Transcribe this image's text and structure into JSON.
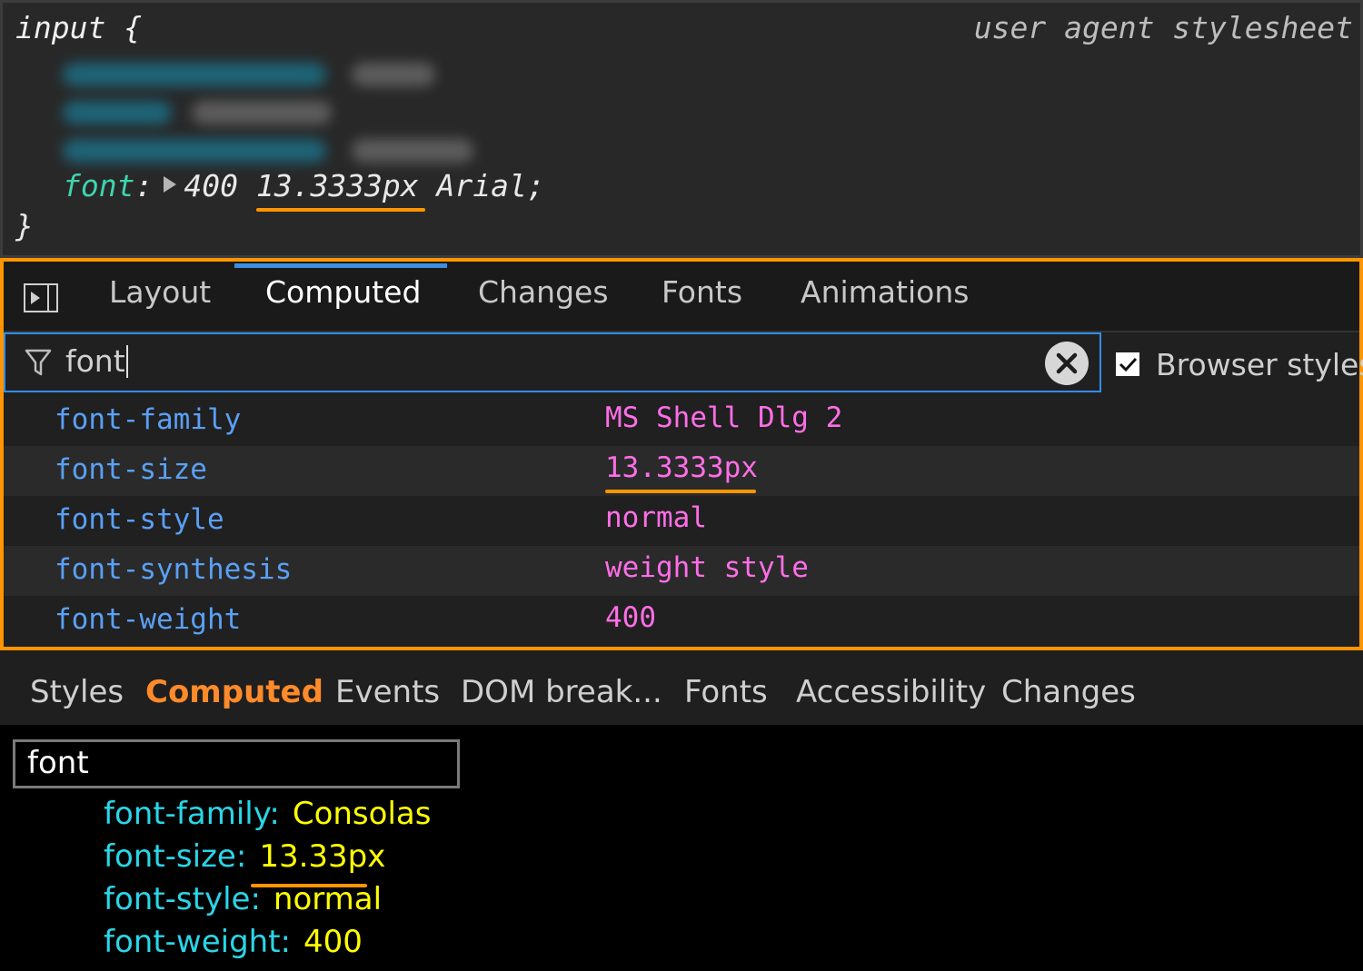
{
  "rule": {
    "selector": "input {",
    "origin": "user agent stylesheet",
    "declaration": {
      "property": "font",
      "colon": ":",
      "weight": "400",
      "size": "13.3333px",
      "family": "Arial;",
      "expand_icon": "triangle-right-icon"
    },
    "close": "}"
  },
  "edge": {
    "toggle_icon": "panel-toggle-icon",
    "tabs": [
      "Layout",
      "Computed",
      "Changes",
      "Fonts",
      "Animations"
    ],
    "active_tab": "Computed",
    "filter": {
      "value": "font",
      "icon": "filter-funnel-icon",
      "clear_icon": "clear-circle-x-icon"
    },
    "browser_styles": {
      "label": "Browser styles",
      "checked": true
    },
    "properties": [
      {
        "name": "font-family",
        "value": "MS Shell Dlg 2"
      },
      {
        "name": "font-size",
        "value": "13.3333px"
      },
      {
        "name": "font-style",
        "value": "normal"
      },
      {
        "name": "font-synthesis",
        "value": "weight style"
      },
      {
        "name": "font-weight",
        "value": "400"
      }
    ],
    "colors": {
      "accent": "#3a8fe0",
      "property": "#5aa0f5",
      "value": "#ff6ee7"
    }
  },
  "firefox": {
    "tabs": [
      "Styles",
      "Computed",
      "Events",
      "DOM break...",
      "Fonts",
      "Accessibility",
      "Changes"
    ],
    "active_tab": "Computed",
    "filter": {
      "value": "font"
    },
    "properties": [
      {
        "name": "font-family:",
        "value": "Consolas"
      },
      {
        "name": "font-size:",
        "value": "13.33px"
      },
      {
        "name": "font-style:",
        "value": "normal"
      },
      {
        "name": "font-weight:",
        "value": "400"
      }
    ],
    "colors": {
      "active_tab": "#ff8a2a",
      "property": "#29d6e8",
      "value": "#ffff00"
    }
  },
  "highlight_color": "#ff9500"
}
